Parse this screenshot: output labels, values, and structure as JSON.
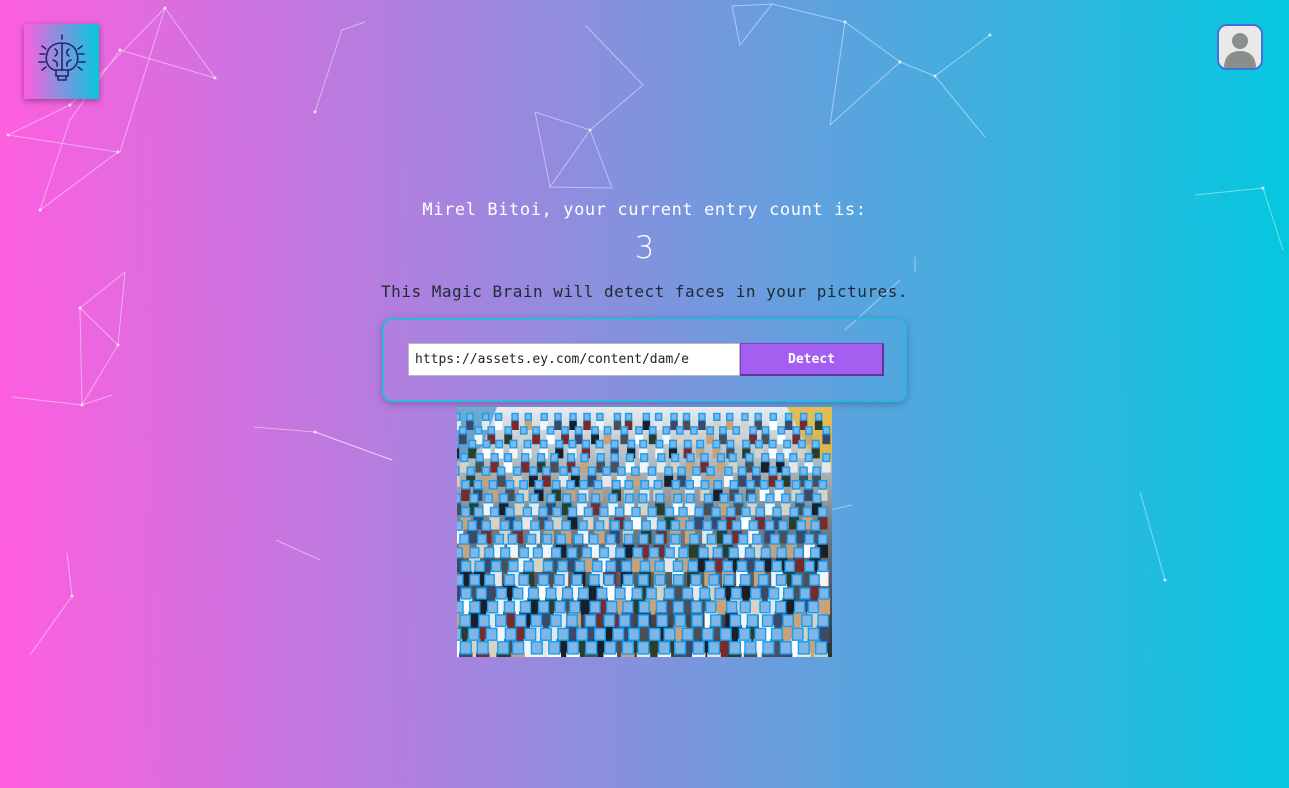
{
  "header": {
    "logo_icon": "brain-lightbulb-icon",
    "avatar_icon": "user-avatar-icon"
  },
  "rank": {
    "message": "Mirel Bitoi, your current entry count is:",
    "count": "3"
  },
  "tagline": "This Magic Brain will detect faces in your pictures.",
  "form": {
    "input_value": "https://assets.ey.com/content/dam/e",
    "button_label": "Detect"
  },
  "result": {
    "image_subject": "crowd-photo",
    "box_color": "#149df2"
  },
  "colors": {
    "gradient_start": "#ff5edf",
    "gradient_end": "#04c8de",
    "button": "#a45ff0",
    "card_border": "#2fb4e6"
  }
}
